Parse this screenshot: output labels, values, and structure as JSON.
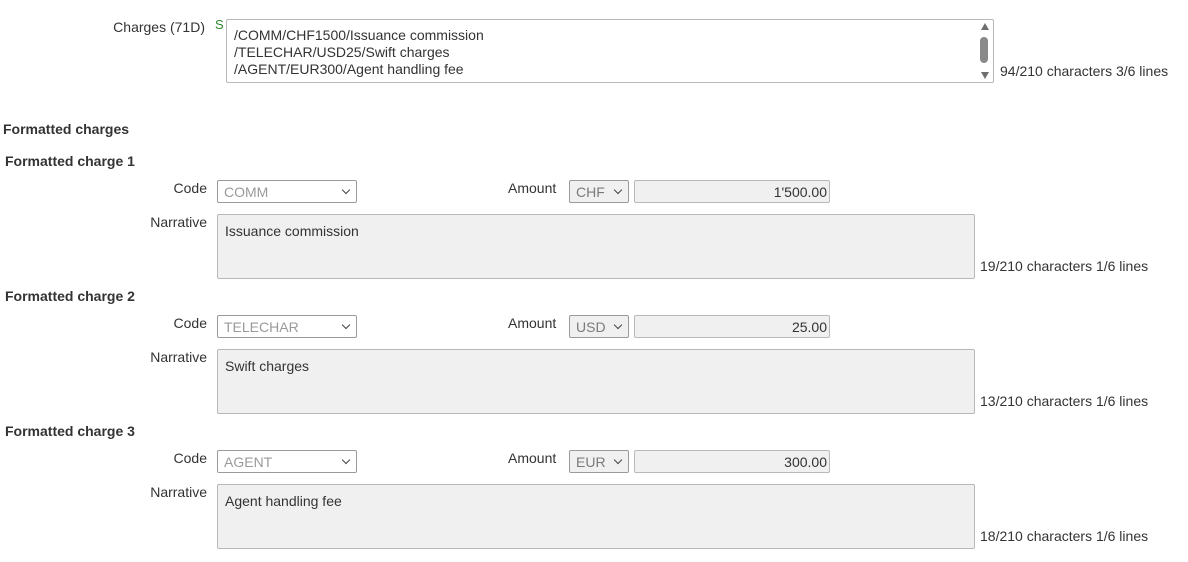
{
  "charges_71d": {
    "label": "Charges (71D)",
    "status_tag": "S",
    "lines": [
      "/COMM/CHF1500/Issuance commission",
      "/TELECHAR/USD25/Swift charges",
      "/AGENT/EUR300/Agent handling fee"
    ],
    "counter": "94/210 characters 3/6 lines"
  },
  "formatted_charges": {
    "title": "Formatted charges",
    "code_label": "Code",
    "amount_label": "Amount",
    "narrative_label": "Narrative",
    "items": [
      {
        "title": "Formatted charge 1",
        "code": "COMM",
        "currency": "CHF",
        "amount": "1'500.00",
        "narrative": "Issuance commission",
        "counter": "19/210 characters 1/6 lines"
      },
      {
        "title": "Formatted charge 2",
        "code": "TELECHAR",
        "currency": "USD",
        "amount": "25.00",
        "narrative": "Swift charges",
        "counter": "13/210 characters 1/6 lines"
      },
      {
        "title": "Formatted charge 3",
        "code": "AGENT",
        "currency": "EUR",
        "amount": "300.00",
        "narrative": "Agent handling fee",
        "counter": "18/210 characters 1/6 lines"
      }
    ]
  },
  "colors": {
    "tag_green": "#2e8b2e",
    "field_readonly_bg": "#f0f0f0",
    "border": "#b8b8b8"
  }
}
